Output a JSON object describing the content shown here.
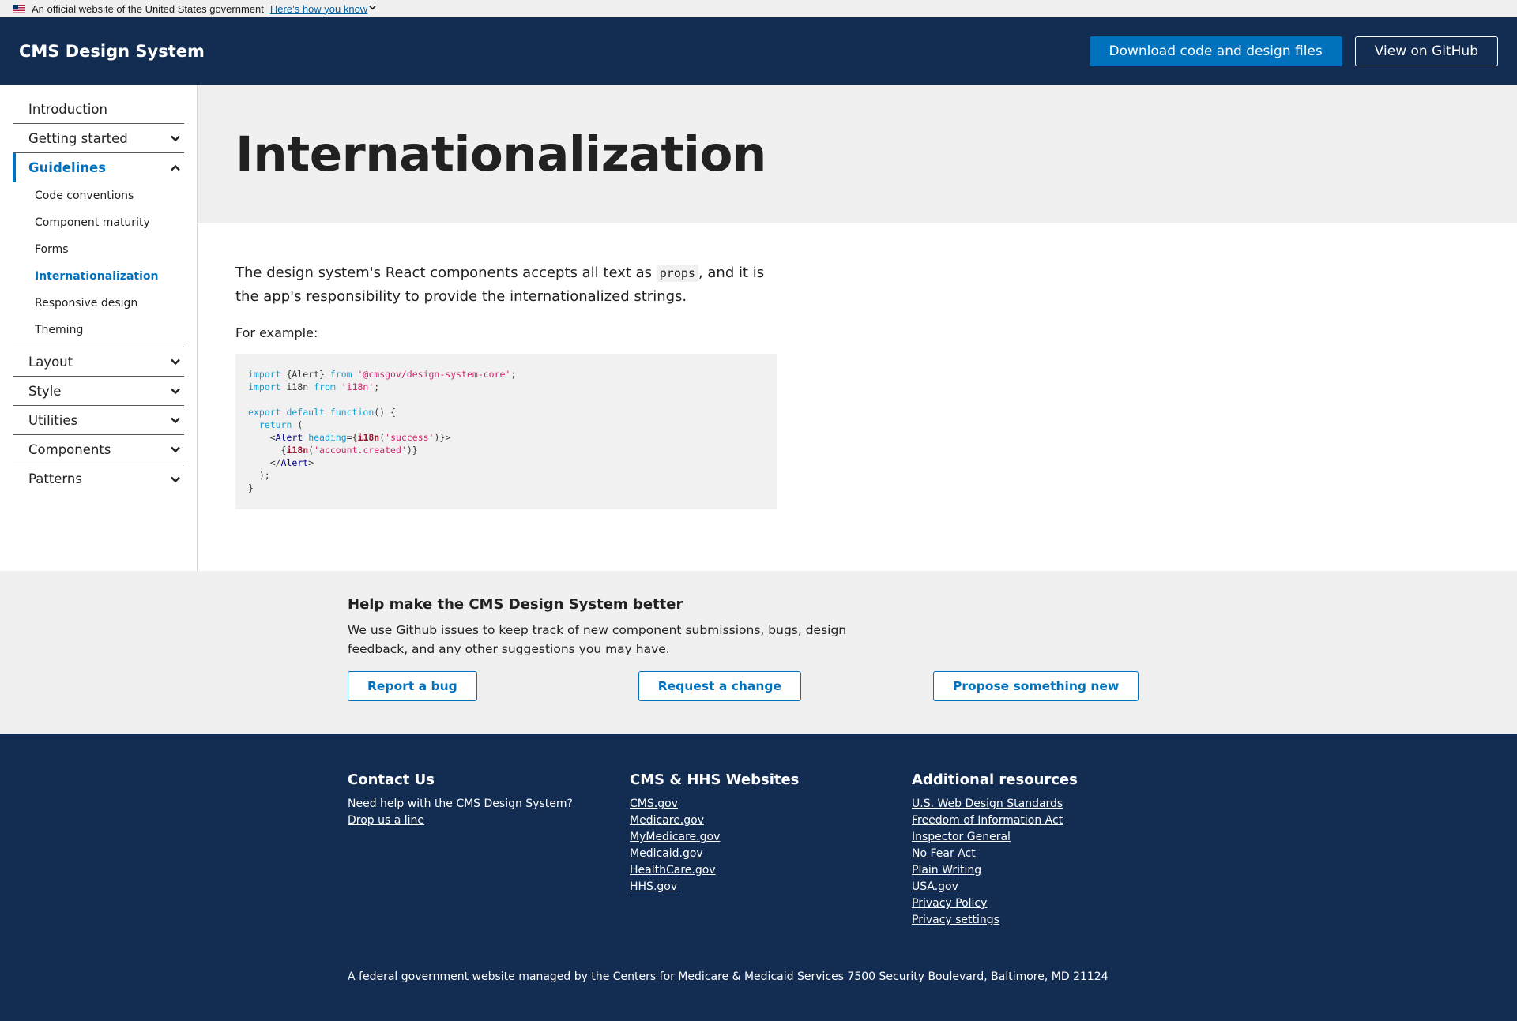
{
  "gov_banner": {
    "text": "An official website of the United States government",
    "link": "Here’s how you know"
  },
  "header": {
    "logo": "CMS Design System",
    "download_label": "Download code and design files",
    "github_label": "View on GitHub"
  },
  "sidebar": {
    "items": [
      {
        "label": "Introduction"
      },
      {
        "label": "Getting started"
      },
      {
        "label": "Guidelines"
      },
      {
        "label": "Layout"
      },
      {
        "label": "Style"
      },
      {
        "label": "Utilities"
      },
      {
        "label": "Components"
      },
      {
        "label": "Patterns"
      }
    ],
    "guidelines_sub": [
      "Code conventions",
      "Component maturity",
      "Forms",
      "Internationalization",
      "Responsive design",
      "Theming"
    ]
  },
  "page": {
    "title": "Internationalization",
    "lead_before": "The design system's React components accepts all text as ",
    "lead_code": "props",
    "lead_after": ", and it is the app's responsibility to provide the internationalized strings.",
    "example_label": "For example:",
    "code": {
      "l1_kw": "import",
      "l1_mid": " {Alert} ",
      "l1_from": "from",
      "l1_str": "'@cmsgov/design-system-core'",
      "l1_end": ";",
      "l2_kw": "import",
      "l2_mid": " i18n ",
      "l2_from": "from",
      "l2_str": "'i18n'",
      "l2_end": ";",
      "l4_kw": "export default function",
      "l4_end": "() {",
      "l5_kw": "return",
      "l5_end": " (",
      "l6_tag": "Alert",
      "l6_attr": "heading",
      "l6_fn": "i18n",
      "l6_str": "'success'",
      "l7_fn": "i18n",
      "l7_str": "'account.created'",
      "l8_tag": "Alert",
      "l9": ");",
      "l10": "}"
    }
  },
  "feedback": {
    "title": "Help make the CMS Design System better",
    "text": "We use Github issues to keep track of new component submissions, bugs, design feedback, and any other suggestions you may have.",
    "report_bug": "Report a bug",
    "request_change": "Request a change",
    "propose_new": "Propose something new"
  },
  "footer": {
    "contact_title": "Contact Us",
    "contact_text": "Need help with the CMS Design System?",
    "contact_link": "Drop us a line",
    "websites_title": "CMS & HHS Websites",
    "websites": [
      "CMS.gov",
      "Medicare.gov",
      "MyMedicare.gov",
      "Medicaid.gov",
      "HealthCare.gov",
      "HHS.gov"
    ],
    "resources_title": "Additional resources",
    "resources": [
      "U.S. Web Design Standards",
      "Freedom of Information Act",
      "Inspector General",
      "No Fear Act",
      "Plain Writing",
      "USA.gov",
      "Privacy Policy",
      "Privacy settings"
    ],
    "bottom": "A federal government website managed by the Centers for Medicare & Medicaid Services 7500 Security Boulevard, Baltimore, MD 21124"
  },
  "colors": {
    "navy": "#132c52",
    "primary": "#0071bc"
  },
  "icons": {
    "chevron_down": "chevron-down-icon",
    "chevron_up": "chevron-up-icon",
    "flag": "us-flag-icon"
  }
}
